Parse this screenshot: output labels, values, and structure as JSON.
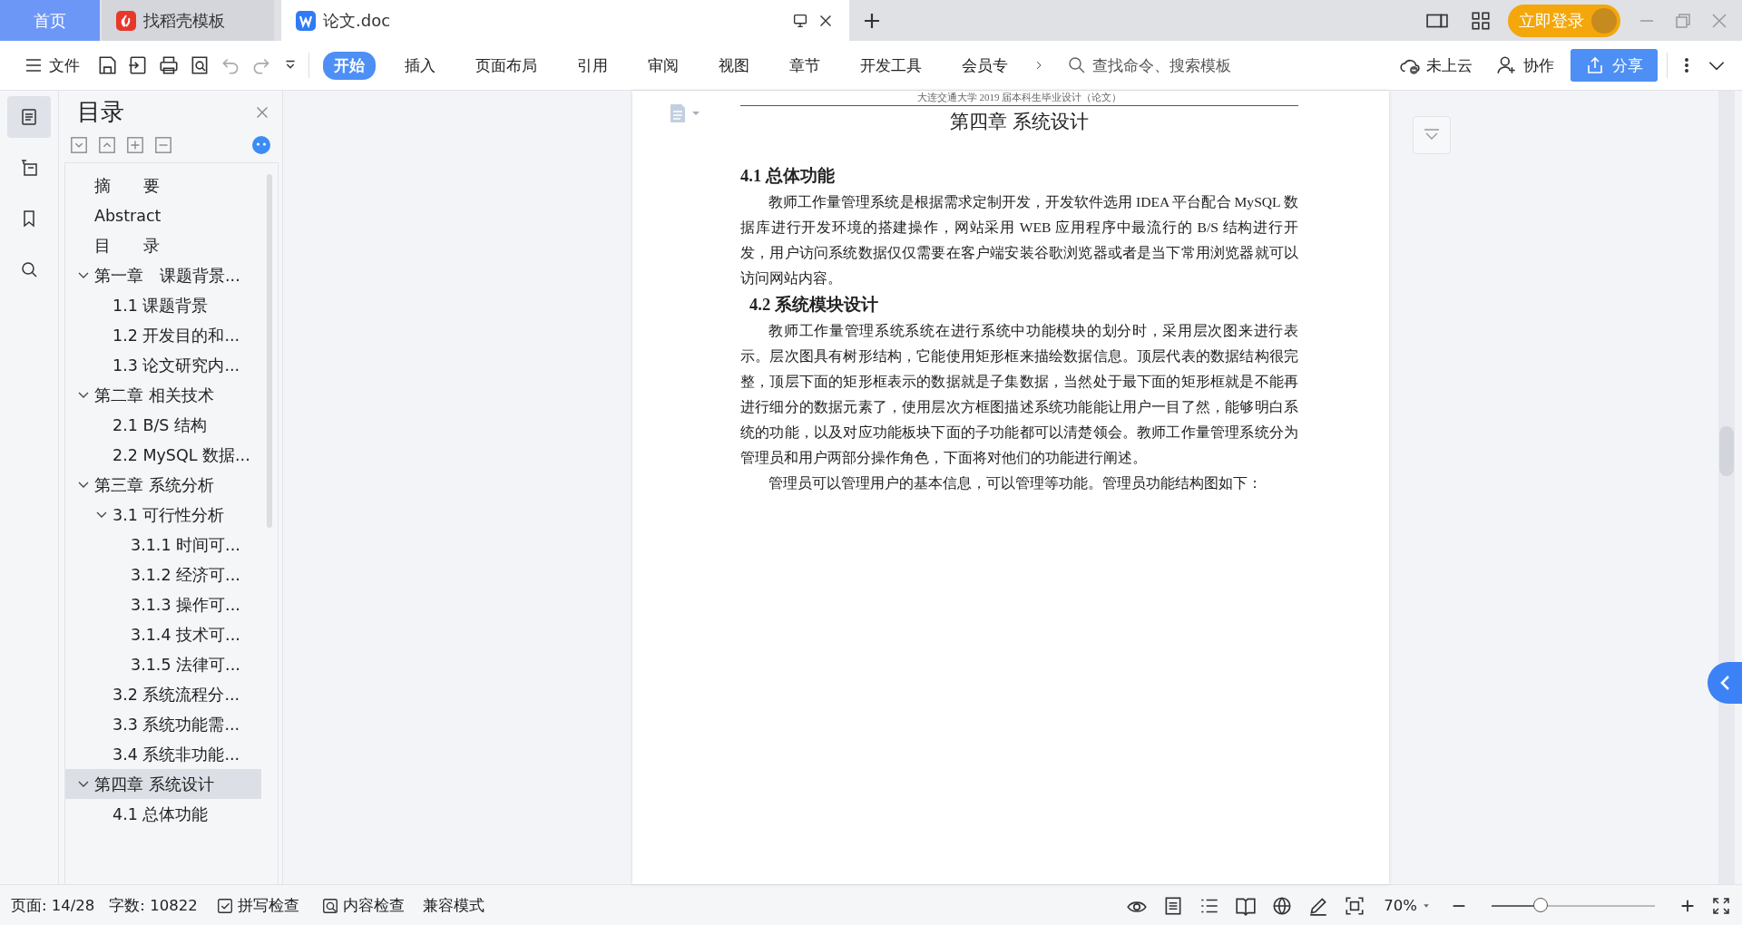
{
  "tabs": [
    {
      "label": "首页",
      "kind": "home",
      "selected": false
    },
    {
      "label": "找稻壳模板",
      "kind": "docer",
      "selected": false
    },
    {
      "label": "论文.doc",
      "kind": "doc",
      "selected": true
    }
  ],
  "login_button": "立即登录",
  "toolbar": {
    "file_menu": "文件",
    "ribbon_tabs": [
      {
        "label": "开始",
        "selected": true
      },
      {
        "label": "插入",
        "selected": false
      },
      {
        "label": "页面布局",
        "selected": false
      },
      {
        "label": "引用",
        "selected": false
      },
      {
        "label": "审阅",
        "selected": false
      },
      {
        "label": "视图",
        "selected": false
      },
      {
        "label": "章节",
        "selected": false
      },
      {
        "label": "开发工具",
        "selected": false
      },
      {
        "label": "会员专",
        "selected": false
      }
    ],
    "search": {
      "placeholder": "查找命令、搜索模板"
    },
    "cloud": "未上云",
    "collaborate": "协作",
    "share": "分享"
  },
  "sidebar": {
    "rail": [
      {
        "kind": "toc",
        "selected": true
      },
      {
        "kind": "outline",
        "selected": false
      },
      {
        "kind": "bookmark",
        "selected": false
      },
      {
        "kind": "search",
        "selected": false
      }
    ],
    "title": "目录",
    "toc": [
      {
        "label": "摘　　要",
        "selected": false
      },
      {
        "label": "Abstract",
        "selected": false
      },
      {
        "label": "目　　录",
        "selected": false
      },
      {
        "label": "第一章　课题背景...",
        "selected": false,
        "expanded": true,
        "children": [
          {
            "label": "1.1  课题背景",
            "selected": false
          },
          {
            "label": "1.2  开发目的和...",
            "selected": false
          },
          {
            "label": "1.3  论文研究内...",
            "selected": false
          }
        ]
      },
      {
        "label": "第二章  相关技术",
        "selected": false,
        "expanded": true,
        "children": [
          {
            "label": "2.1 B/S 结构",
            "selected": false
          },
          {
            "label": "2.2 MySQL 数据...",
            "selected": false
          }
        ]
      },
      {
        "label": "第三章  系统分析",
        "selected": false,
        "expanded": true,
        "children": [
          {
            "label": "3.1 可行性分析",
            "selected": false,
            "expanded": true,
            "children": [
              {
                "label": "3.1.1 时间可...",
                "selected": false
              },
              {
                "label": "3.1.2  经济可...",
                "selected": false
              },
              {
                "label": "3.1.3  操作可...",
                "selected": false
              },
              {
                "label": "3.1.4  技术可...",
                "selected": false
              },
              {
                "label": "3.1.5  法律可...",
                "selected": false
              }
            ]
          },
          {
            "label": "3.2 系统流程分...",
            "selected": false
          },
          {
            "label": "3.3 系统功能需...",
            "selected": false
          },
          {
            "label": "3.4  系统非功能...",
            "selected": false
          }
        ]
      },
      {
        "label": "第四章  系统设计",
        "selected": true,
        "expanded": true,
        "children": [
          {
            "label": "4.1  总体功能",
            "selected": false
          }
        ]
      }
    ]
  },
  "document": {
    "running_header": "大连交通大学 2019 届本科生毕业设计（论文）",
    "chapter_title": "第四章  系统设计",
    "sections": [
      {
        "heading": "4.1  总体功能",
        "paragraphs": [
          "教师工作量管理系统是根据需求定制开发，开发软件选用 IDEA 平台配合 MySQL 数据库进行开发环境的搭建操作，网站采用 WEB 应用程序中最流行的 B/S 结构进行开发，用户访问系统数据仅仅需要在客户端安装谷歌浏览器或者是当下常用浏览器就可以访问网站内容。"
        ]
      },
      {
        "heading": "4.2  系统模块设计",
        "paragraphs": [
          "教师工作量管理系统系统在进行系统中功能模块的划分时，采用层次图来进行表示。层次图具有树形结构，它能使用矩形框来描绘数据信息。顶层代表的数据结构很完整，顶层下面的矩形框表示的数据就是子集数据，当然处于最下面的矩形框就是不能再进行细分的数据元素了，使用层次方框图描述系统功能能让用户一目了然，能够明白系统的功能，以及对应功能板块下面的子功能都可以清楚领会。教师工作量管理系统分为管理员和用户两部分操作角色，下面将对他们的功能进行阐述。",
          "管理员可以管理用户的基本信息，可以管理等功能。管理员功能结构图如下："
        ]
      }
    ]
  },
  "status_bar": {
    "page": "页面: 14/28",
    "words": "字数: 10822",
    "spell_check": "拼写检查",
    "content_check": "内容检查",
    "compat_mode": "兼容模式",
    "zoom": "70%",
    "zoom_slider": {
      "level": 0.3
    }
  }
}
